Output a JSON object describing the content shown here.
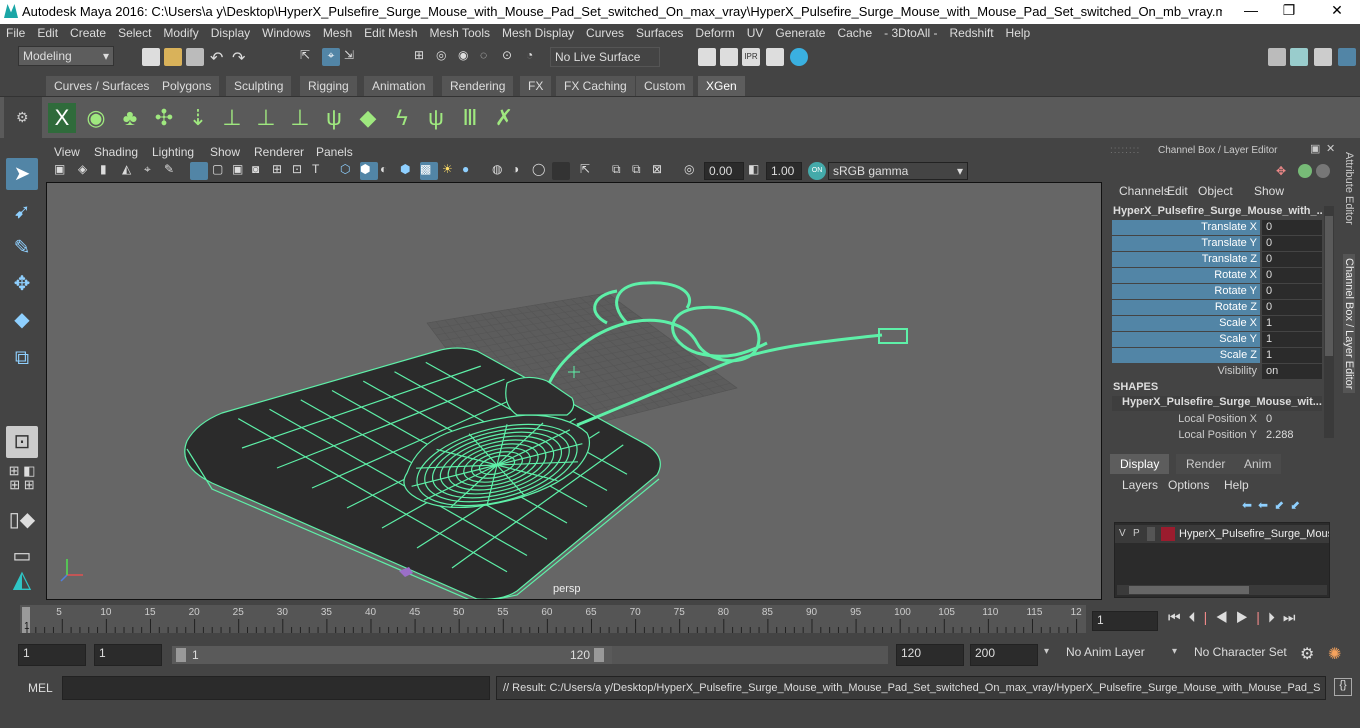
{
  "window": {
    "title": "Autodesk Maya 2016: C:\\Users\\a y\\Desktop\\HyperX_Pulsefire_Surge_Mouse_with_Mouse_Pad_Set_switched_On_max_vray\\HyperX_Pulsefire_Surge_Mouse_with_Mouse_Pad_Set_switched_On_mb_vray.mb   ---   HyperX_Pulsefir...",
    "minimize": "—",
    "maximize": "❐",
    "close": "✕"
  },
  "menubar": [
    "File",
    "Edit",
    "Create",
    "Select",
    "Modify",
    "Display",
    "Windows",
    "Mesh",
    "Edit Mesh",
    "Mesh Tools",
    "Mesh Display",
    "Curves",
    "Surfaces",
    "Deform",
    "UV",
    "Generate",
    "Cache",
    "- 3DtoAll -",
    "Redshift",
    "Help"
  ],
  "status": {
    "mode": "Modeling",
    "live_surface": "No Live Surface"
  },
  "shelf_tabs": [
    "Curves / Surfaces",
    "Polygons",
    "Sculpting",
    "Rigging",
    "Animation",
    "Rendering",
    "FX",
    "FX Caching",
    "Custom",
    "XGen"
  ],
  "shelf_active": "XGen",
  "viewport_menu": [
    "View",
    "Shading",
    "Lighting",
    "Show",
    "Renderer",
    "Panels"
  ],
  "viewport_toolbar": {
    "field1": "0.00",
    "field2": "1.00",
    "color_space": "sRGB gamma"
  },
  "viewport": {
    "camera_label": "persp",
    "wire_color": "#5ef0a8",
    "bg_color": "#666666"
  },
  "channel_box": {
    "title": "Channel Box / Layer Editor",
    "menu": [
      "Channels",
      "Edit",
      "Object",
      "Show"
    ],
    "object_name": "HyperX_Pulsefire_Surge_Mouse_with_...",
    "attributes": [
      {
        "label": "Translate X",
        "value": "0"
      },
      {
        "label": "Translate Y",
        "value": "0"
      },
      {
        "label": "Translate Z",
        "value": "0"
      },
      {
        "label": "Rotate X",
        "value": "0"
      },
      {
        "label": "Rotate Y",
        "value": "0"
      },
      {
        "label": "Rotate Z",
        "value": "0"
      },
      {
        "label": "Scale X",
        "value": "1"
      },
      {
        "label": "Scale Y",
        "value": "1"
      },
      {
        "label": "Scale Z",
        "value": "1"
      },
      {
        "label": "Visibility",
        "value": "on"
      }
    ],
    "shapes_header": "SHAPES",
    "shape_name": "HyperX_Pulsefire_Surge_Mouse_wit...",
    "shape_attrs": [
      {
        "label": "Local Position X",
        "value": "0"
      },
      {
        "label": "Local Position Y",
        "value": "2.288"
      }
    ]
  },
  "layer_editor": {
    "tabs": [
      "Display",
      "Render",
      "Anim"
    ],
    "active_tab": "Display",
    "menu": [
      "Layers",
      "Options",
      "Help"
    ],
    "layer": {
      "v": "V",
      "p": "P",
      "name": "HyperX_Pulsefire_Surge_Mouse",
      "color": "#9b1c2e"
    }
  },
  "side_tabs": [
    "Attribute Editor",
    "Channel Box / Layer Editor"
  ],
  "timeline": {
    "ticks": [
      "5",
      "10",
      "15",
      "20",
      "25",
      "30",
      "35",
      "40",
      "45",
      "50",
      "55",
      "60",
      "65",
      "70",
      "75",
      "80",
      "85",
      "90",
      "95",
      "100",
      "105",
      "110",
      "115",
      "12"
    ],
    "start_marker": "1",
    "current_frame": "1"
  },
  "range": {
    "start": "1",
    "inner_start": "1",
    "slider_start": "1",
    "slider_end": "120",
    "end": "120",
    "outer_end": "200",
    "anim_layer": "No Anim Layer",
    "char_set": "No Character Set"
  },
  "command": {
    "label": "MEL",
    "result": "// Result: C:/Users/a y/Desktop/HyperX_Pulsefire_Surge_Mouse_with_Mouse_Pad_Set_switched_On_max_vray/HyperX_Pulsefire_Surge_Mouse_with_Mouse_Pad_S"
  }
}
